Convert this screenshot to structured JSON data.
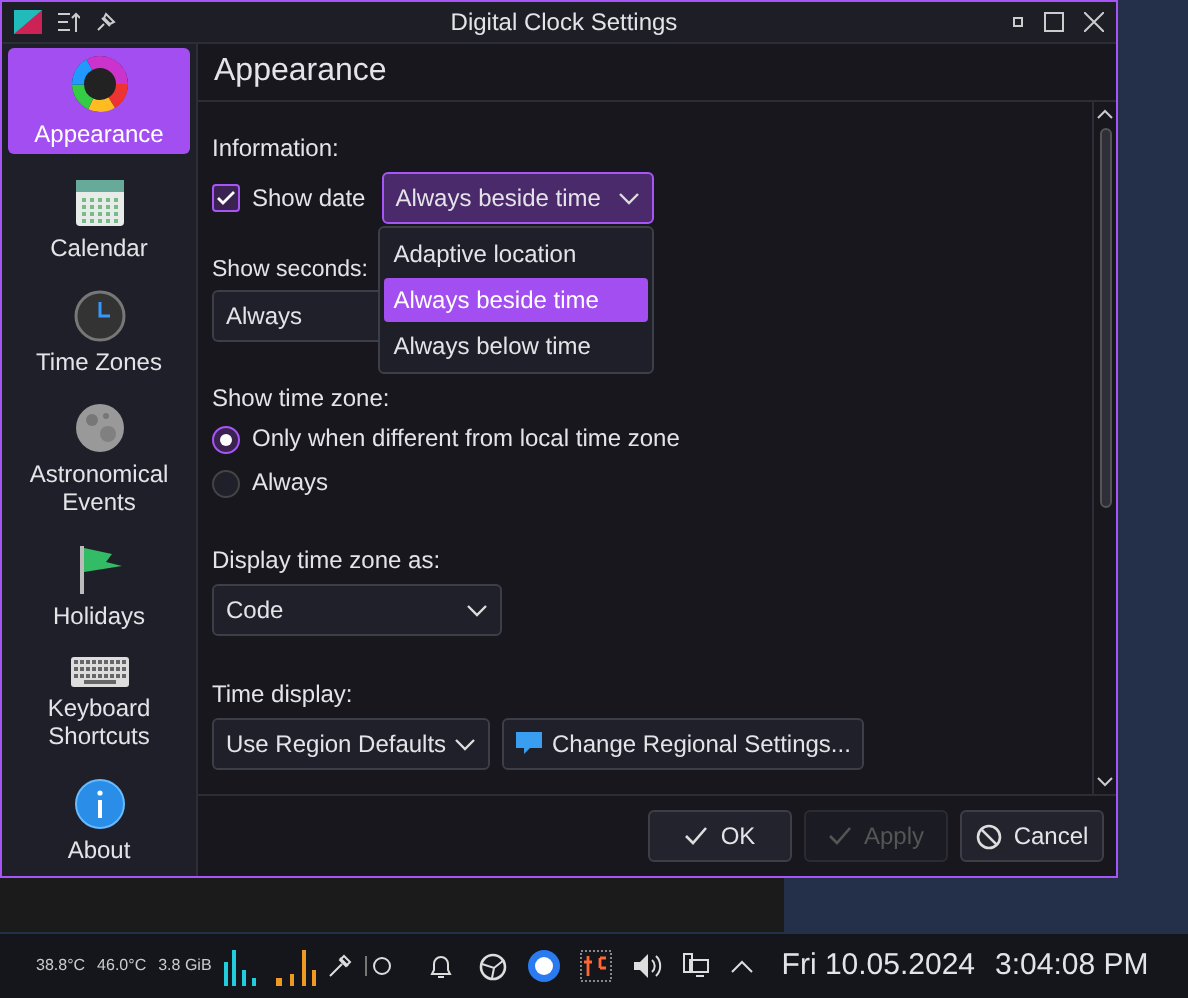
{
  "window": {
    "title": "Digital Clock Settings"
  },
  "sidebar": {
    "items": [
      {
        "label": "Appearance",
        "kind": "palette",
        "selected": true
      },
      {
        "label": "Calendar",
        "kind": "calendar",
        "selected": false
      },
      {
        "label": "Time Zones",
        "kind": "clock",
        "selected": false
      },
      {
        "label": "Astronomical Events",
        "kind": "moon",
        "selected": false
      },
      {
        "label": "Holidays",
        "kind": "flag",
        "selected": false
      },
      {
        "label": "Keyboard Shortcuts",
        "kind": "keyboard",
        "selected": false
      },
      {
        "label": "About",
        "kind": "info",
        "selected": false
      }
    ]
  },
  "page": {
    "title": "Appearance",
    "information": {
      "label": "Information:",
      "show_date": {
        "label": "Show date",
        "checked": true,
        "value": "Always beside time",
        "expanded": true,
        "options": [
          {
            "label": "Adaptive location",
            "selected": false
          },
          {
            "label": "Always beside time",
            "selected": true
          },
          {
            "label": "Always below time",
            "selected": false
          }
        ]
      }
    },
    "show_seconds": {
      "label": "Show seconds:",
      "value": "Always"
    },
    "show_time_zone": {
      "label": "Show time zone:",
      "options": [
        {
          "label": "Only when different from local time zone",
          "selected": true
        },
        {
          "label": "Always",
          "selected": false
        }
      ]
    },
    "display_time_zone_as": {
      "label": "Display time zone as:",
      "value": "Code"
    },
    "time_display": {
      "label": "Time display:",
      "value": "Use Region Defaults",
      "button": "Change Regional Settings..."
    }
  },
  "buttons": [
    {
      "label": "OK",
      "kind": "ok",
      "disabled": false
    },
    {
      "label": "Apply",
      "kind": "apply",
      "disabled": true
    },
    {
      "label": "Cancel",
      "kind": "cancel",
      "disabled": false
    }
  ],
  "taskbar": {
    "readings": [
      "38.8°C",
      "46.0°C",
      "3.8 GiB"
    ],
    "date": "Fri 10.05.2024",
    "time": "3:04:08 PM"
  }
}
